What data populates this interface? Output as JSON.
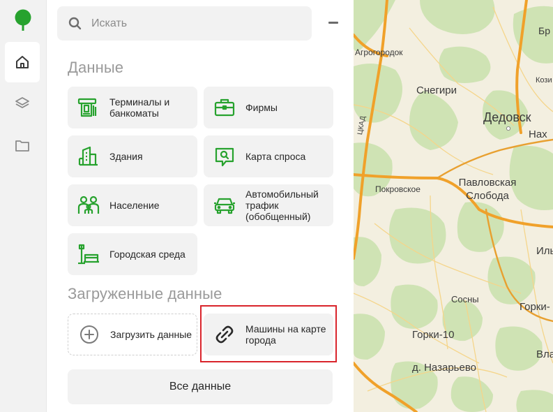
{
  "search": {
    "placeholder": "Искать"
  },
  "sidebar": {
    "items": [
      {
        "name": "home-icon"
      },
      {
        "name": "layers-icon"
      },
      {
        "name": "folder-icon"
      }
    ]
  },
  "sections": {
    "data_title": "Данные",
    "uploaded_title": "Загруженные данные"
  },
  "data_cards": [
    {
      "label": "Терминалы и банкоматы",
      "icon": "atm-icon"
    },
    {
      "label": "Фирмы",
      "icon": "briefcase-icon"
    },
    {
      "label": "Здания",
      "icon": "building-icon"
    },
    {
      "label": "Карта спроса",
      "icon": "search-bubble-icon"
    },
    {
      "label": "Население",
      "icon": "people-icon"
    },
    {
      "label": "Автомобильный трафик (обобщенный)",
      "icon": "car-icon"
    },
    {
      "label": "Городская среда",
      "icon": "bench-lamp-icon"
    }
  ],
  "uploaded_cards": [
    {
      "label": "Загрузить данные",
      "icon": "plus-circle-icon"
    },
    {
      "label": "Машины на карте города",
      "icon": "link-icon"
    }
  ],
  "all_data_button": "Все данные",
  "map": {
    "labels": [
      "Агрогородок",
      "Бр",
      "Снегири",
      "Дедовск",
      "Нах",
      "Кози",
      "ЦКАД",
      "Покровское",
      "Павловская Слобода",
      "Иль",
      "Сосны",
      "Горки-",
      "Горки-10",
      "Вла",
      "д. Назарьево"
    ]
  },
  "colors": {
    "accent_green": "#27a22e",
    "highlight_red": "#d9242b"
  }
}
